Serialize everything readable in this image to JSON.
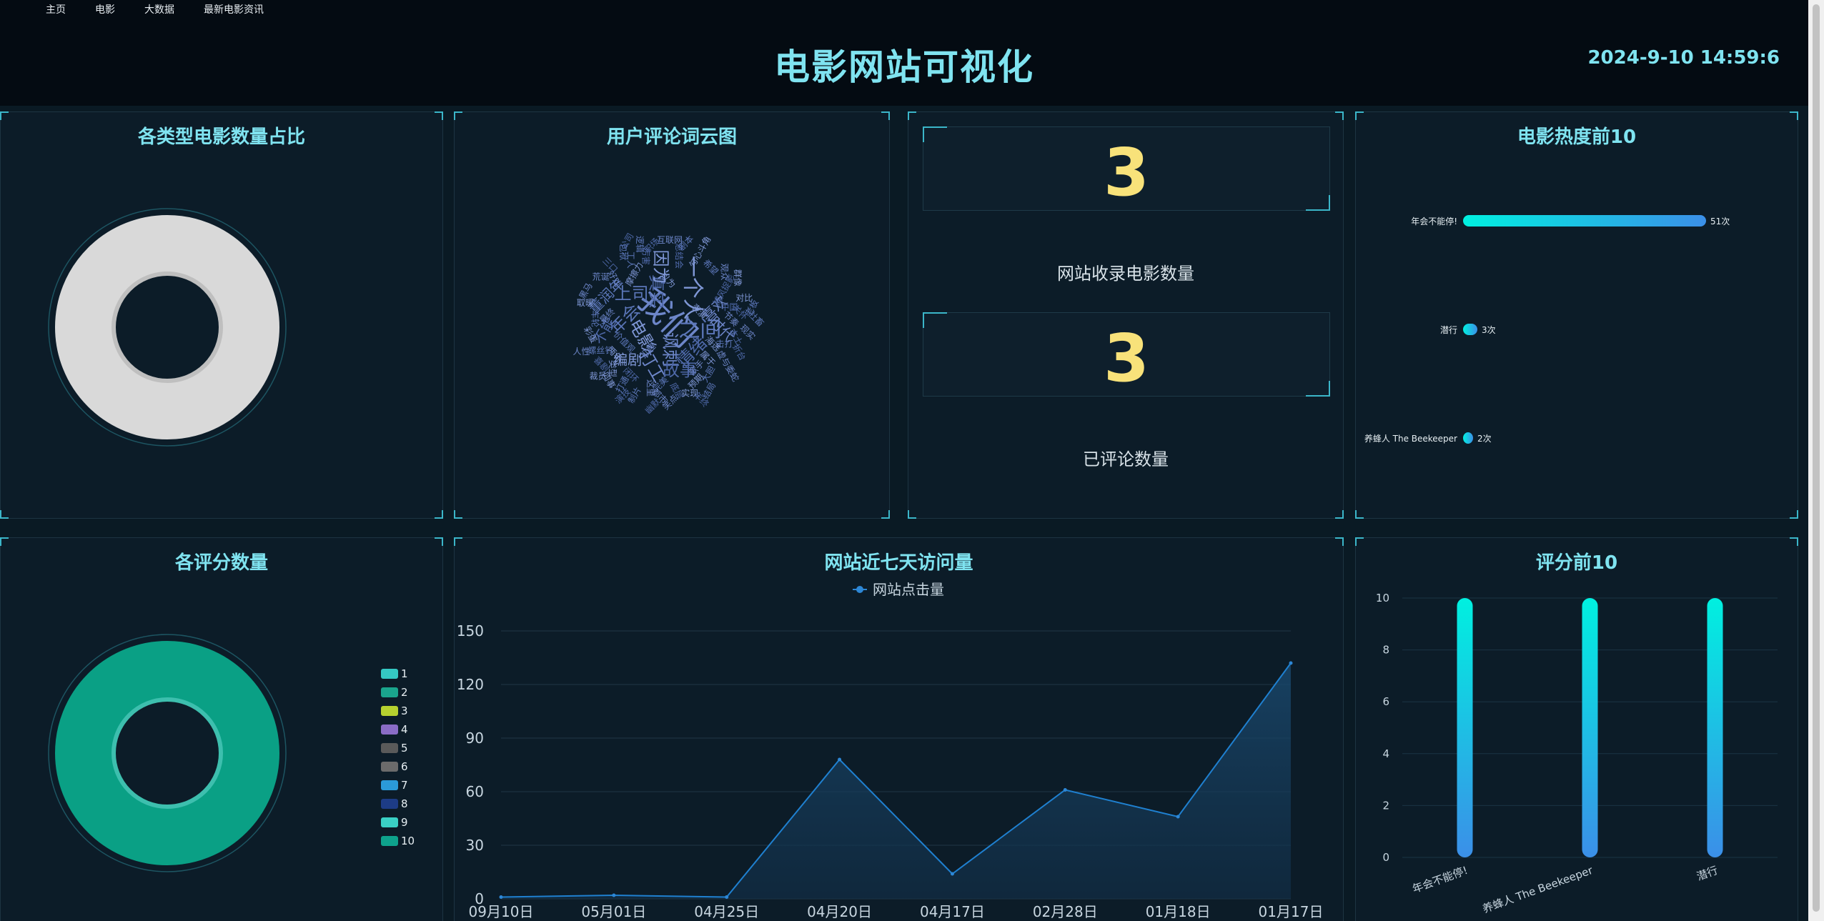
{
  "nav": {
    "items": [
      "主页",
      "电影",
      "大数据",
      "最新电影资讯"
    ]
  },
  "header": {
    "title": "电影网站可视化",
    "datetime": "2024-9-10 14:59:6"
  },
  "panels": {
    "type_share": {
      "title": "各类型电影数量占比"
    },
    "wordcloud": {
      "title": "用户评论词云图",
      "words": [
        {
          "t": "我们",
          "w": 9
        },
        {
          "t": "之间",
          "w": 6
        },
        {
          "t": "一个人",
          "w": 6
        },
        {
          "t": "真实",
          "w": 5
        },
        {
          "t": "讽刺",
          "w": 5
        },
        {
          "t": "年会",
          "w": 5
        },
        {
          "t": "电影",
          "w": 5
        },
        {
          "t": "情绪",
          "w": 5
        },
        {
          "t": "打工",
          "w": 5
        },
        {
          "t": "上司",
          "w": 5
        },
        {
          "t": "因为",
          "w": 5
        },
        {
          "t": "故事",
          "w": 5
        },
        {
          "t": "时代",
          "w": 4
        },
        {
          "t": "董润年",
          "w": 4
        },
        {
          "t": "编剧",
          "w": 4
        },
        {
          "t": "不能",
          "w": 4
        },
        {
          "t": "喜欢",
          "w": 4
        },
        {
          "t": "价值观",
          "w": 2
        },
        {
          "t": "摩擦力",
          "w": 2
        },
        {
          "t": "总结会",
          "w": 2
        },
        {
          "t": "打趣",
          "w": 2
        },
        {
          "t": "击打",
          "w": 2
        },
        {
          "t": "属于",
          "w": 2
        },
        {
          "t": "捕风捉影",
          "w": 2
        },
        {
          "t": "好戏",
          "w": 2
        },
        {
          "t": "车轮",
          "w": 2
        },
        {
          "t": "勾心斗角",
          "w": 2
        },
        {
          "t": "中国",
          "w": 2
        },
        {
          "t": "最终",
          "w": 2
        },
        {
          "t": "完美",
          "w": 2
        },
        {
          "t": "两年",
          "w": 2
        },
        {
          "t": "厉害",
          "w": 2
        },
        {
          "t": "歌手",
          "w": 2
        },
        {
          "t": "希望",
          "w": 2
        },
        {
          "t": "预期",
          "w": 2
        },
        {
          "t": "闭环",
          "w": 2
        },
        {
          "t": "这里",
          "w": 2
        },
        {
          "t": "工人",
          "w": 2
        },
        {
          "t": "以为",
          "w": 2
        },
        {
          "t": "本土",
          "w": 2
        },
        {
          "t": "虚与委蛇",
          "w": 2
        },
        {
          "t": "螺丝钉",
          "w": 2
        },
        {
          "t": "类型",
          "w": 2
        },
        {
          "t": "底层",
          "w": 2
        },
        {
          "t": "黑马",
          "w": 2
        },
        {
          "t": "大胆",
          "w": 2
        },
        {
          "t": "海选",
          "w": 2
        },
        {
          "t": "关怀",
          "w": 2
        },
        {
          "t": "互联网",
          "w": 2
        },
        {
          "t": "逻辑",
          "w": 2
        },
        {
          "t": "实现",
          "w": 2
        },
        {
          "t": "三口",
          "w": 2
        },
        {
          "t": "现实",
          "w": 2
        },
        {
          "t": "制片",
          "w": 2
        },
        {
          "t": "取暖",
          "w": 2
        },
        {
          "t": "折台",
          "w": 2
        },
        {
          "t": "都市",
          "w": 2
        },
        {
          "t": "打通",
          "w": 2
        },
        {
          "t": "彩蛋",
          "w": 2
        },
        {
          "t": "职场",
          "w": 2
        },
        {
          "t": "观众",
          "w": 2
        },
        {
          "t": "包袱",
          "w": 2
        },
        {
          "t": "对比",
          "w": 2
        },
        {
          "t": "幽默",
          "w": 2
        },
        {
          "t": "荒诞",
          "w": 2
        },
        {
          "t": "结局",
          "w": 2
        },
        {
          "t": "群像",
          "w": 2
        },
        {
          "t": "演技",
          "w": 2
        },
        {
          "t": "节奏",
          "w": 2
        },
        {
          "t": "社畜",
          "w": 2
        },
        {
          "t": "裁员",
          "w": 2
        },
        {
          "t": "公司",
          "w": 2
        },
        {
          "t": "笑点",
          "w": 2
        },
        {
          "t": "剧本",
          "w": 2
        },
        {
          "t": "表演",
          "w": 2
        },
        {
          "t": "喜剧",
          "w": 2
        },
        {
          "t": "人性",
          "w": 2
        },
        {
          "t": "老板",
          "w": 2
        },
        {
          "t": "同事",
          "w": 2
        },
        {
          "t": "年终",
          "w": 2
        }
      ]
    },
    "stats": {
      "movie_count": "3",
      "movie_count_label": "网站收录电影数量",
      "comment_count": "3",
      "comment_count_label": "已评论数量"
    },
    "hot_top10": {
      "title": "电影热度前10"
    },
    "score_count": {
      "title": "各评分数量"
    },
    "visits": {
      "title": "网站近七天访问量"
    },
    "score_top10": {
      "title": "评分前10"
    }
  },
  "chart_data": [
    {
      "type": "pie",
      "title": "各类型电影数量占比",
      "slices": [
        {
          "name": "",
          "value": 1,
          "color": "#d9d9d9"
        }
      ]
    },
    {
      "type": "bar",
      "title": "电影热度前10",
      "orientation": "horizontal",
      "categories": [
        "年会不能停!",
        "潜行",
        "养蜂人 The Beekeeper"
      ],
      "values": [
        51,
        3,
        2
      ],
      "value_suffix": "次",
      "colors": [
        "#00f0e0",
        "#3b8fe8"
      ]
    },
    {
      "type": "pie",
      "title": "各评分数量",
      "legend": [
        "1",
        "2",
        "3",
        "4",
        "5",
        "6",
        "7",
        "8",
        "9",
        "10"
      ],
      "legend_colors": [
        "#35c9c3",
        "#1aa58d",
        "#b6d12f",
        "#8a6cc6",
        "#5a5a5a",
        "#6b6b6b",
        "#2b9ad8",
        "#1d3c86",
        "#3ad0c5",
        "#0ea28c"
      ],
      "slices": [
        {
          "name": "10",
          "value": 3,
          "color": "#0aa085"
        }
      ],
      "legend_placement": "right"
    },
    {
      "type": "area",
      "title": "网站近七天访问量",
      "series": [
        {
          "name": "网站点击量",
          "values": [
            1,
            2,
            1,
            78,
            14,
            61,
            46,
            132
          ]
        }
      ],
      "categories": [
        "09月10日",
        "05月01日",
        "04月25日",
        "04月20日",
        "04月17日",
        "02月28日",
        "01月18日",
        "01月17日"
      ],
      "ylim": [
        0,
        150
      ],
      "yticks": [
        0,
        30,
        60,
        90,
        120,
        150
      ],
      "legend_placement": "top"
    },
    {
      "type": "bar",
      "title": "评分前10",
      "categories": [
        "年会不能停!",
        "养蜂人 The Beekeeper",
        "潜行"
      ],
      "values": [
        10,
        10,
        10
      ],
      "ylim": [
        0,
        10
      ],
      "yticks": [
        0,
        2,
        4,
        6,
        8,
        10
      ]
    }
  ]
}
